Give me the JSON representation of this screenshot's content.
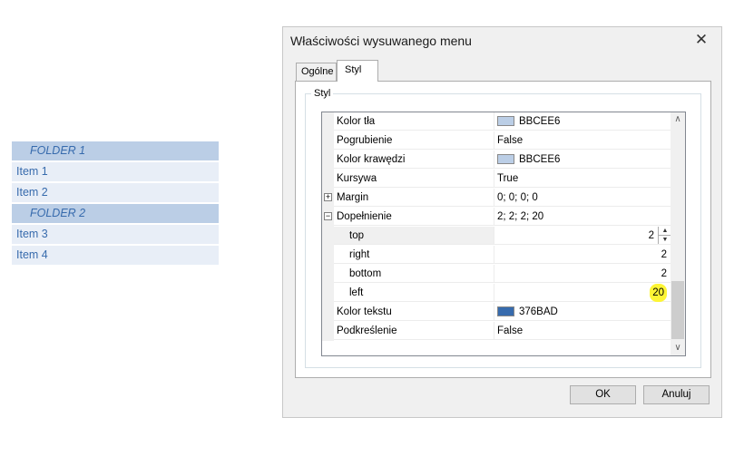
{
  "menu_preview": {
    "rows": [
      {
        "type": "folder",
        "label": "FOLDER 1"
      },
      {
        "type": "item",
        "label": "Item 1"
      },
      {
        "type": "item",
        "label": "Item 2"
      },
      {
        "type": "folder",
        "label": "FOLDER 2"
      },
      {
        "type": "item",
        "label": "Item 3"
      },
      {
        "type": "item",
        "label": "Item 4"
      }
    ]
  },
  "dialog": {
    "title": "Właściwości wysuwanego menu",
    "close_icon": "close-icon",
    "tabs": [
      {
        "label": "Ogólne",
        "active": false
      },
      {
        "label": "Styl",
        "active": true
      }
    ],
    "group_label": "Styl",
    "properties": [
      {
        "name": "Kolor tła",
        "value": "BBCEE6",
        "swatch": "#bbcee6"
      },
      {
        "name": "Pogrubienie",
        "value": "False"
      },
      {
        "name": "Kolor krawędzi",
        "value": "BBCEE6",
        "swatch": "#bbcee6"
      },
      {
        "name": "Kursywa",
        "value": "True"
      },
      {
        "name": "Margin",
        "value": "0; 0; 0; 0",
        "expander": "+"
      },
      {
        "name": "Dopełnienie",
        "value": "2; 2; 2; 20",
        "expander": "−"
      },
      {
        "name": "top",
        "value": "2",
        "sub": true,
        "stepper": true,
        "selected": true
      },
      {
        "name": "right",
        "value": "2",
        "sub": true
      },
      {
        "name": "bottom",
        "value": "2",
        "sub": true
      },
      {
        "name": "left",
        "value": "20",
        "sub": true,
        "highlight": true
      },
      {
        "name": "Kolor tekstu",
        "value": "376BAD",
        "swatch": "#376bad"
      },
      {
        "name": "Podkreślenie",
        "value": "False"
      }
    ],
    "stepper": {
      "up": "▲",
      "down": "▼"
    },
    "scroll": {
      "up": "∧",
      "down": "∨"
    },
    "buttons": {
      "ok": "OK",
      "cancel": "Anuluj"
    }
  },
  "colors": {
    "folder_bg": "#bbcee6",
    "item_bg": "#e8eef7",
    "menu_text": "#376bad",
    "highlight": "#fdf535"
  }
}
